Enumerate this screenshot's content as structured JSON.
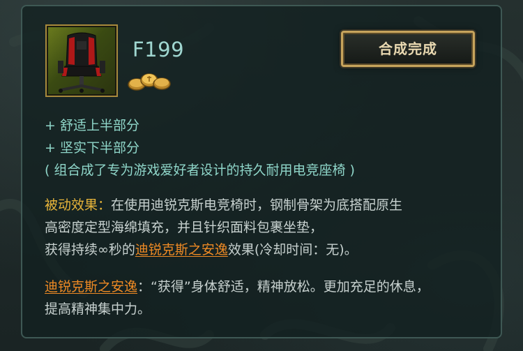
{
  "item": {
    "name": "F199",
    "icon": "gaming-chair-icon",
    "cost_icon": "gold-coins-icon"
  },
  "status_button": {
    "label": "合成完成"
  },
  "recipe": {
    "components": [
      "+ 舒适上半部分",
      "+ 坚实下半部分"
    ],
    "note": "( 组合成了专为游戏爱好者设计的持久耐用电竞座椅 )"
  },
  "passive": {
    "label": "被动效果：",
    "line1_text": "在使用迪锐克斯电竞椅时，钢制骨架为底搭配原生",
    "line2_text": "高密度定型海绵填充，并且针织面料包裹坐垫，",
    "line3_prefix": "获得持续∞秒的",
    "line3_link": "迪锐克斯之安逸",
    "line3_suffix": "效果(冷却时间：无)。"
  },
  "effect": {
    "name": "迪锐克斯之安逸",
    "line1_text": "：“获得”身体舒适，精神放松。更加充足的休息，",
    "line2_text": "提高精神集中力。"
  },
  "colors": {
    "item_name": "#9fd6d0",
    "recipe_text": "#8fd6c9",
    "passive_label": "#e7b43a",
    "link": "#ee8a24",
    "body_text": "#c7d1cf",
    "button_border": "#c7a45c"
  }
}
